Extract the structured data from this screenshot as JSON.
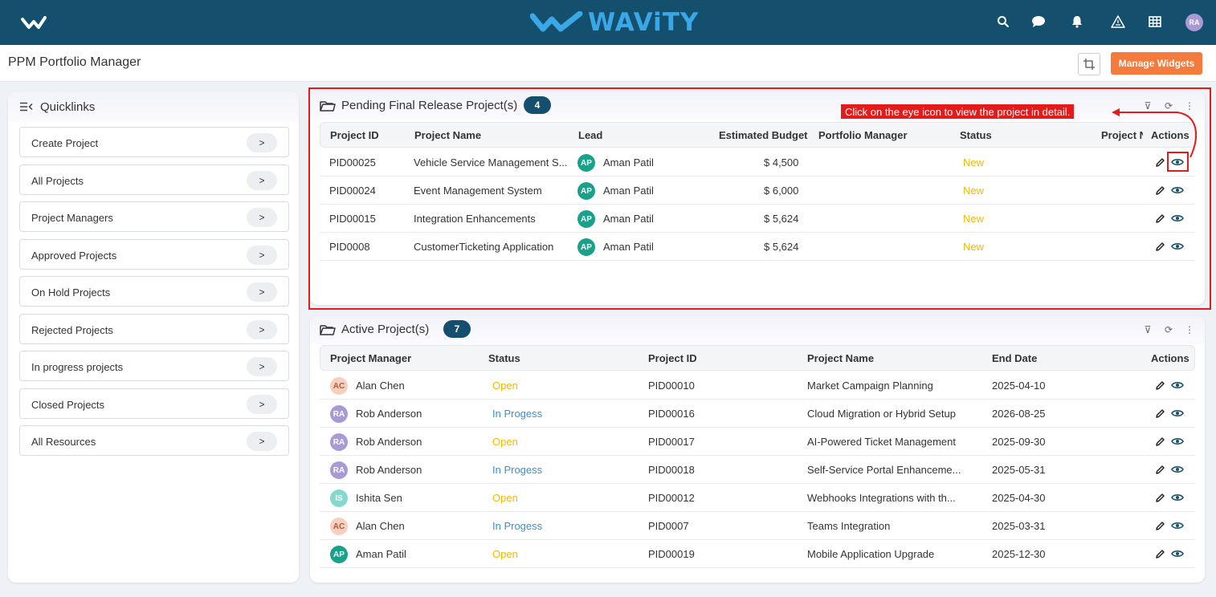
{
  "app": {
    "brand": "WAViTY",
    "user_initials": "RA"
  },
  "header": {
    "page_title": "PPM Portfolio Manager",
    "manage_widgets": "Manage Widgets"
  },
  "quicklinks": {
    "title": "Quicklinks",
    "items": [
      {
        "label": "Create Project"
      },
      {
        "label": "All Projects"
      },
      {
        "label": "Project Managers"
      },
      {
        "label": "Approved Projects"
      },
      {
        "label": "On Hold Projects"
      },
      {
        "label": "Rejected Projects"
      },
      {
        "label": "In progress projects"
      },
      {
        "label": "Closed Projects"
      },
      {
        "label": "All Resources"
      }
    ],
    "arrow": ">"
  },
  "pending": {
    "title": "Pending Final Release Project(s)",
    "count": "4",
    "columns": [
      "Project ID",
      "Project Name",
      "Lead",
      "Estimated Budget",
      "Portfolio Manager",
      "Status",
      "Project N",
      "Actions"
    ],
    "rows": [
      {
        "id": "PID00025",
        "name": "Vehicle Service Management S...",
        "lead_initials": "AP",
        "lead": "Aman Patil",
        "budget": "$ 4,500",
        "pm": "",
        "status": "New"
      },
      {
        "id": "PID00024",
        "name": "Event Management System",
        "lead_initials": "AP",
        "lead": "Aman Patil",
        "budget": "$ 6,000",
        "pm": "",
        "status": "New"
      },
      {
        "id": "PID00015",
        "name": "Integration Enhancements",
        "lead_initials": "AP",
        "lead": "Aman Patil",
        "budget": "$ 5,624",
        "pm": "",
        "status": "New"
      },
      {
        "id": "PID0008",
        "name": "CustomerTicketing Application",
        "lead_initials": "AP",
        "lead": "Aman Patil",
        "budget": "$ 5,624",
        "pm": "",
        "status": "New"
      }
    ]
  },
  "active": {
    "title": "Active Project(s)",
    "count": "7",
    "columns": [
      "Project Manager",
      "Status",
      "Project ID",
      "Project Name",
      "End Date",
      "Actions"
    ],
    "rows": [
      {
        "initials": "AC",
        "manager": "Alan Chen",
        "status": "Open",
        "id": "PID00010",
        "name": "Market Campaign Planning",
        "end": "2025-04-10"
      },
      {
        "initials": "RA",
        "manager": "Rob Anderson",
        "status": "In Progess",
        "id": "PID00016",
        "name": "Cloud Migration or Hybrid Setup",
        "end": "2026-08-25"
      },
      {
        "initials": "RA",
        "manager": "Rob Anderson",
        "status": "Open",
        "id": "PID00017",
        "name": "AI-Powered Ticket Management",
        "end": "2025-09-30"
      },
      {
        "initials": "RA",
        "manager": "Rob Anderson",
        "status": "In Progess",
        "id": "PID00018",
        "name": "Self-Service Portal Enhanceme...",
        "end": "2025-05-31"
      },
      {
        "initials": "IS",
        "manager": "Ishita Sen",
        "status": "Open",
        "id": "PID00012",
        "name": "Webhooks Integrations with th...",
        "end": "2025-04-30"
      },
      {
        "initials": "AC",
        "manager": "Alan Chen",
        "status": "In Progess",
        "id": "PID0007",
        "name": "Teams Integration",
        "end": "2025-03-31"
      },
      {
        "initials": "AP",
        "manager": "Aman Patil",
        "status": "Open",
        "id": "PID00019",
        "name": "Mobile Application Upgrade",
        "end": "2025-12-30"
      }
    ]
  },
  "annotation": {
    "callout": "Click on the eye icon to view the project in detail."
  },
  "colors": {
    "topbar": "#14506e",
    "accent": "#f47b3c",
    "status_new": "#f5b800",
    "status_progress": "#3a8fcf",
    "annotation": "#e31b1b"
  },
  "icons": [
    "home-logo-icon",
    "search-icon",
    "chat-icon",
    "bell-icon",
    "warning-icon",
    "grid-icon",
    "crop-icon",
    "folder-icon",
    "filter-icon",
    "refresh-icon",
    "more-icon",
    "edit-icon",
    "eye-icon",
    "quicklinks-menu-icon"
  ]
}
